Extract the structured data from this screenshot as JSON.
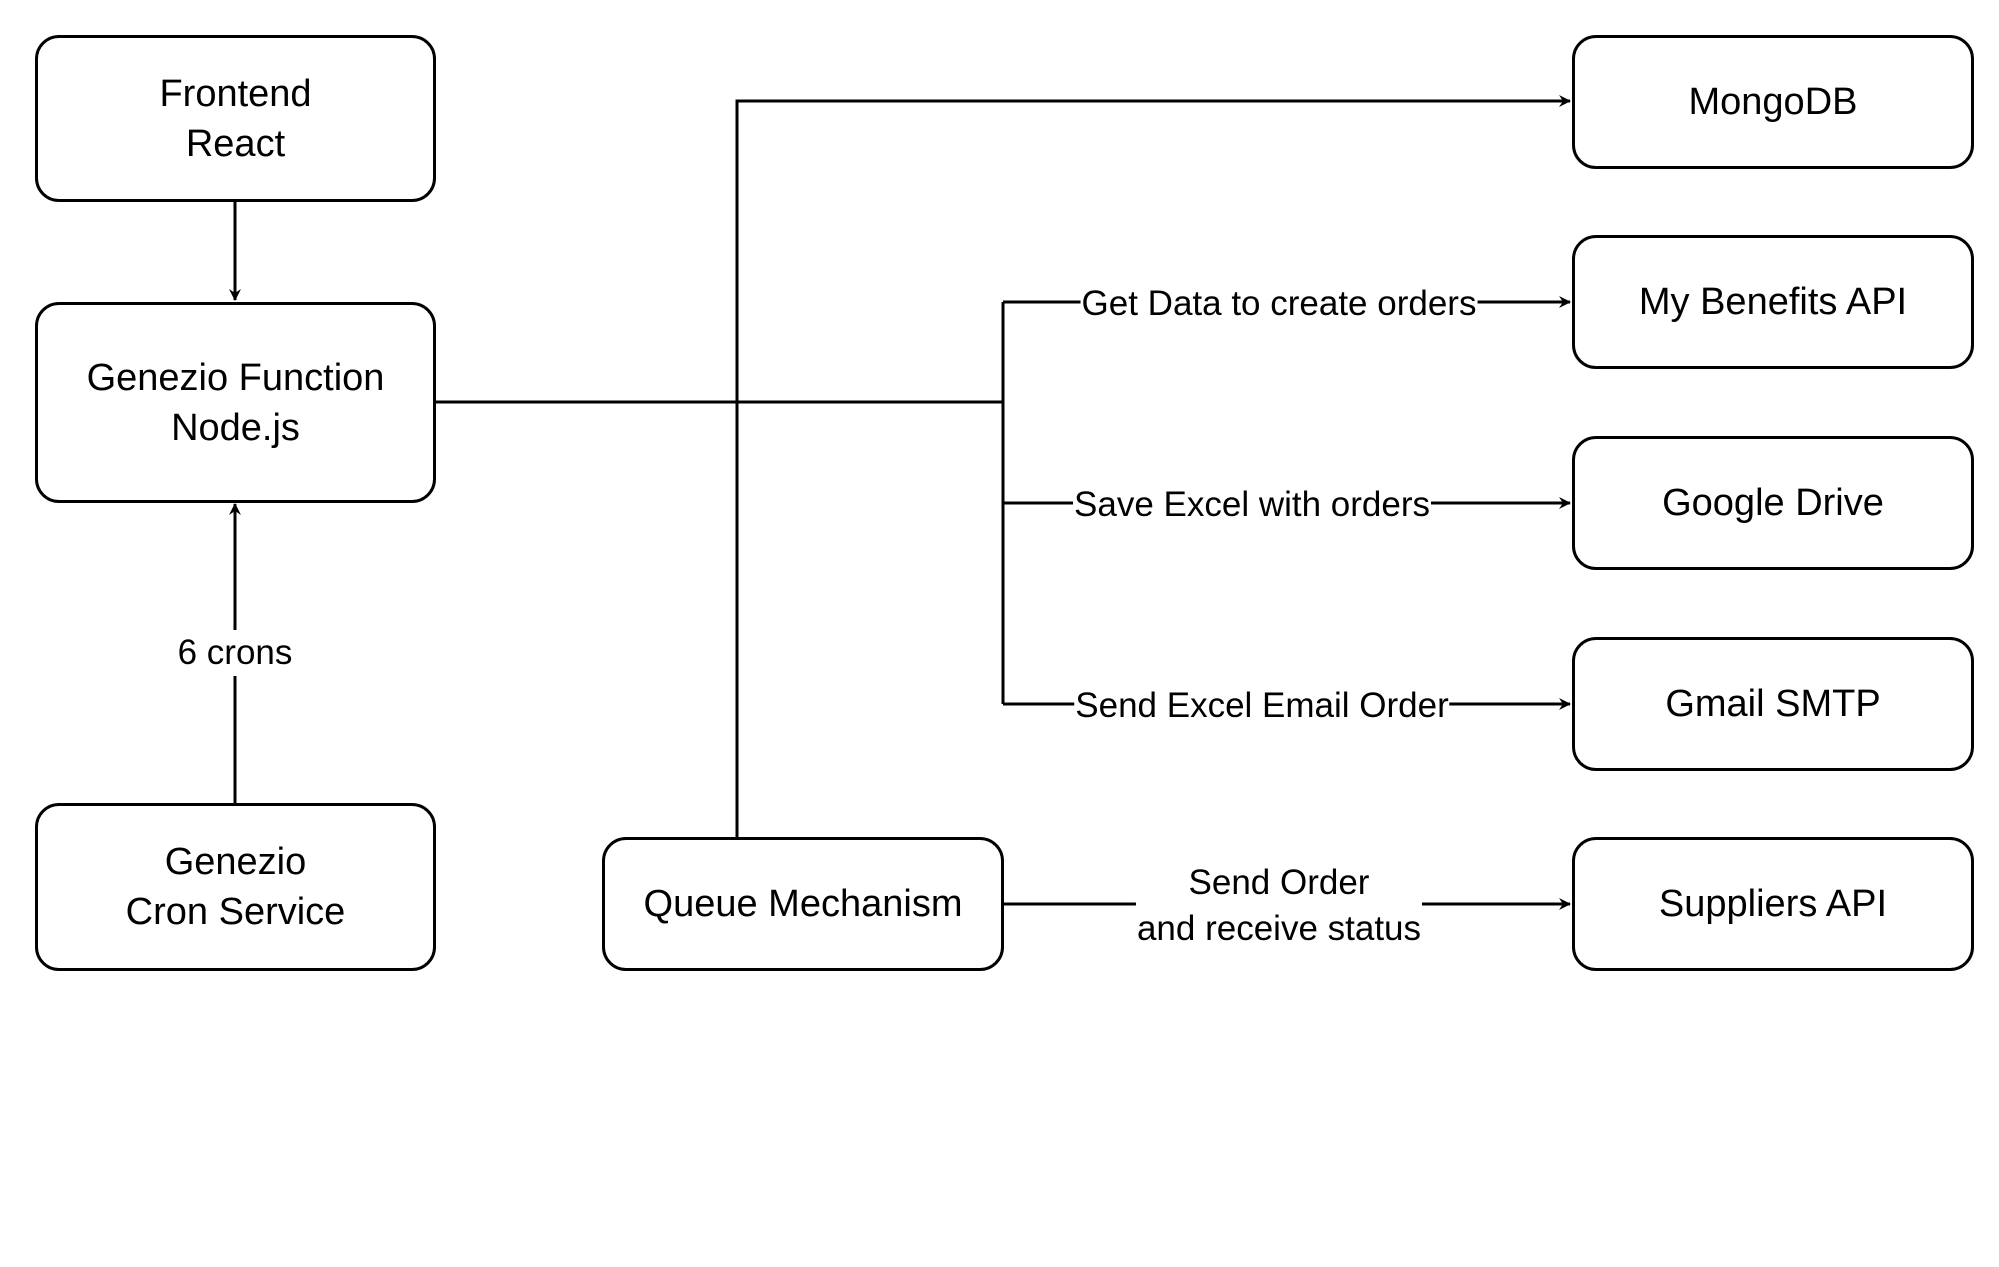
{
  "nodes": {
    "frontend": "Frontend\nReact",
    "function": "Genezio Function\nNode.js",
    "cron": "Genezio\nCron Service",
    "queue": "Queue Mechanism",
    "mongodb": "MongoDB",
    "mybenefits": "My Benefits API",
    "gdrive": "Google Drive",
    "gmail": "Gmail SMTP",
    "suppliers": "Suppliers API"
  },
  "edges": {
    "cron_to_function": "6 crons",
    "to_mybenefits": "Get Data to create orders",
    "to_gdrive": "Save Excel with orders",
    "to_gmail": "Send Excel Email Order",
    "to_suppliers": "Send Order\nand receive status"
  }
}
